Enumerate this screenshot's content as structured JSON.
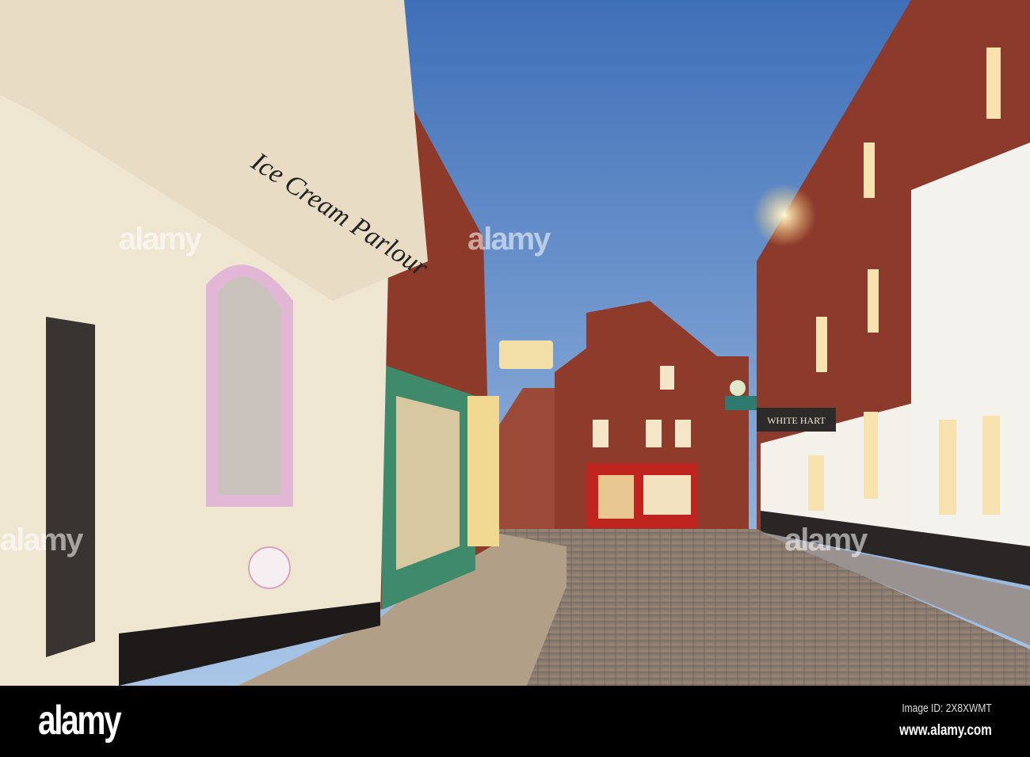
{
  "photo": {
    "signs": {
      "ice_cream": "Ice Cream Parlour",
      "hotel": "WHITE HART"
    },
    "watermark_text": "alamy"
  },
  "footer": {
    "logo": "alamy",
    "image_id": "Image ID: 2X8XWMT",
    "url": "www.alamy.com"
  },
  "colors": {
    "sky_top": "#3f6fb8",
    "sky_bottom": "#a9c6e6",
    "cream": "#efe6d2",
    "brick": "#8a3b2a",
    "shop_green": "#3f8a6a",
    "shop_red": "#c0241e",
    "cobble": "#8a7a6c"
  }
}
